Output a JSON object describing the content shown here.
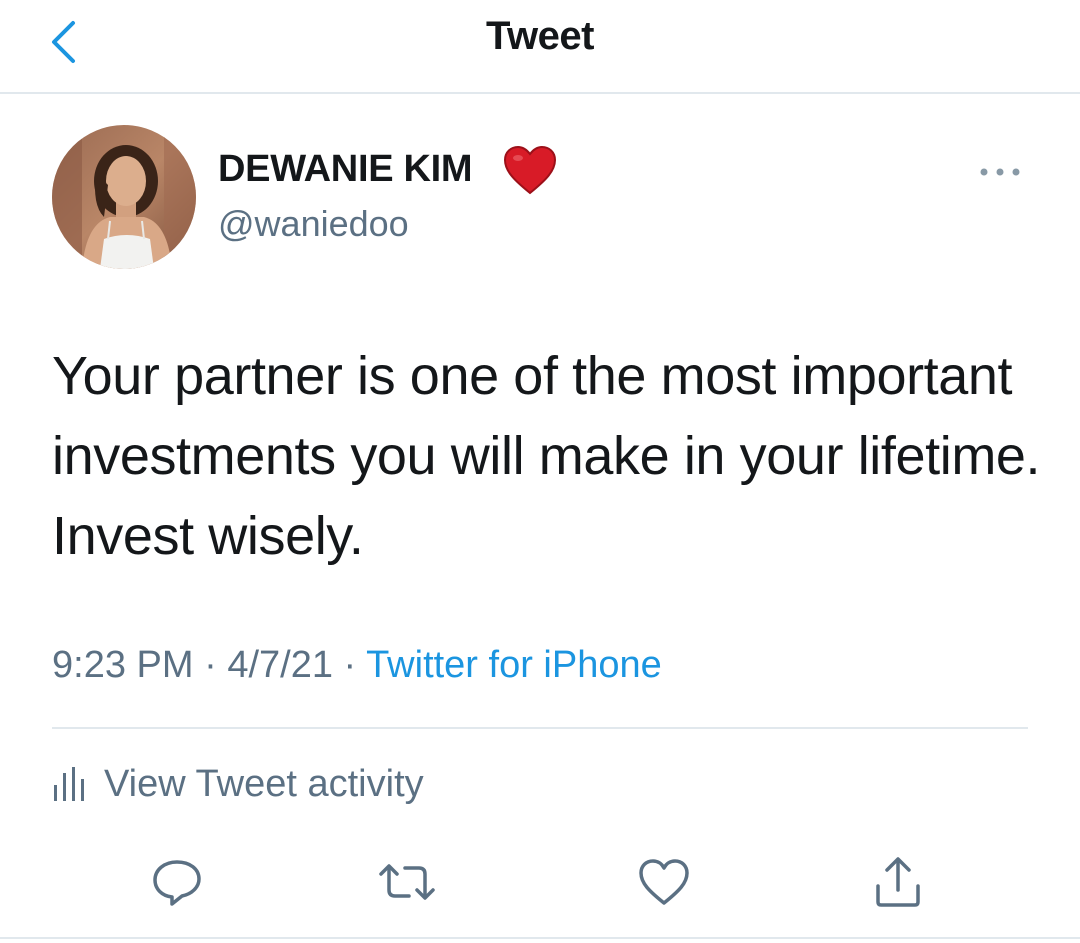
{
  "header": {
    "title": "Tweet",
    "back_icon": "chevron-left-icon"
  },
  "colors": {
    "accent": "#1b95e0",
    "text_primary": "#14171a",
    "text_secondary": "#5b7083",
    "divider": "#e1e8ed",
    "heart": "#d81b27"
  },
  "author": {
    "display_name": "DEWANIE KIM",
    "name_emoji": "red-heart-emoji",
    "handle": "@waniedoo"
  },
  "tweet": {
    "text": "Your partner is one of the most important investments you will make in your lifetime. Invest wisely.",
    "time": "9:23 PM",
    "separator": "·",
    "date": "4/7/21",
    "source": "Twitter for iPhone"
  },
  "activity": {
    "label": "View Tweet activity",
    "icon": "bar-chart-icon"
  },
  "actions": [
    {
      "name": "reply",
      "icon": "reply-icon"
    },
    {
      "name": "retweet",
      "icon": "retweet-icon"
    },
    {
      "name": "like",
      "icon": "heart-icon"
    },
    {
      "name": "share",
      "icon": "share-icon"
    }
  ],
  "more_icon": "more-dots-icon"
}
